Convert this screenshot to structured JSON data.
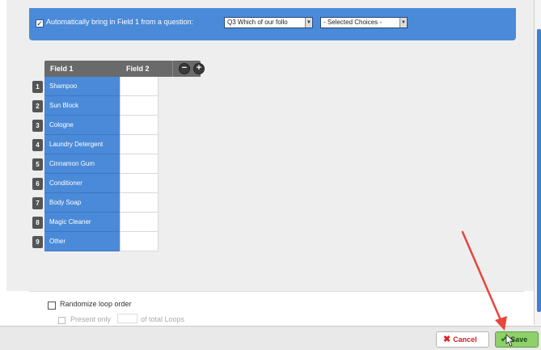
{
  "header": {
    "auto_label": "Automatically bring in Field 1 from a question:",
    "question_select": "Q3 Which of our follo",
    "choices_select": "- Selected Choices -"
  },
  "grid": {
    "columns": [
      "Field 1",
      "Field 2"
    ],
    "remove_icon": "minus-circle-icon",
    "add_icon": "plus-circle-icon",
    "rows": [
      {
        "num": "1",
        "field1": "Shampoo",
        "field2": ""
      },
      {
        "num": "2",
        "field1": "Sun Block",
        "field2": ""
      },
      {
        "num": "3",
        "field1": "Cologne",
        "field2": ""
      },
      {
        "num": "4",
        "field1": "Laundry Detergent",
        "field2": ""
      },
      {
        "num": "5",
        "field1": "Cinnamon Gum",
        "field2": ""
      },
      {
        "num": "6",
        "field1": "Conditioner",
        "field2": ""
      },
      {
        "num": "7",
        "field1": "Body Soap",
        "field2": ""
      },
      {
        "num": "8",
        "field1": "Magic Cleaner",
        "field2": ""
      },
      {
        "num": "9",
        "field1": "Other",
        "field2": ""
      }
    ]
  },
  "options": {
    "randomize_label": "Randomize loop order",
    "present_label": "Present only",
    "loops_label": "of total Loops"
  },
  "footer": {
    "cancel_label": "Cancel",
    "save_label": "Save"
  },
  "colors": {
    "accent_blue": "#4a8ad8",
    "save_green": "#8fd06a",
    "cancel_red": "#cc2222",
    "annotation_arrow": "#e8453c"
  }
}
